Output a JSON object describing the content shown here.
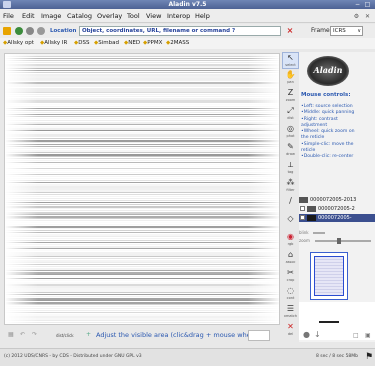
{
  "window": {
    "title": "Aladin v7.5",
    "controls": [
      "−",
      "□"
    ]
  },
  "menu": {
    "items": [
      "File",
      "Edit",
      "Image",
      "Catalog",
      "Overlay",
      "Tool",
      "View",
      "Interop",
      "Help"
    ]
  },
  "toolbar": {
    "location_label": "Location",
    "location_value": "Object, coordinates, URL, filename or command ?",
    "clear": "×",
    "frame_label": "Frame",
    "frame_value": "ICRS",
    "frame_arrow": "∨"
  },
  "surveys": [
    "Allsky opt",
    "Allsky IR",
    "DSS",
    "Simbad",
    "NED",
    "PPMX",
    "2MASS"
  ],
  "tools": [
    {
      "label": "select",
      "icon": "↖"
    },
    {
      "label": "pan",
      "icon": "✋"
    },
    {
      "label": "zoom",
      "icon": "Z"
    },
    {
      "label": "dist",
      "icon": "⤢"
    },
    {
      "label": "phot",
      "icon": "◎"
    },
    {
      "label": "draw",
      "icon": "✎"
    },
    {
      "label": "tag",
      "icon": "⟂"
    },
    {
      "label": "filter",
      "icon": "⁂"
    },
    {
      "label": "",
      "icon": "∕"
    },
    {
      "label": "",
      "icon": "◇"
    },
    {
      "label": "rgb",
      "icon": "◉"
    },
    {
      "label": "assoc",
      "icon": "⌂"
    },
    {
      "label": "crop",
      "icon": "✂"
    },
    {
      "label": "cont",
      "icon": "◌"
    },
    {
      "label": "xmatch",
      "icon": "☰"
    },
    {
      "label": "prop",
      "icon": "☐"
    },
    {
      "label": "del",
      "icon": "✕"
    }
  ],
  "mouse_controls": {
    "title": "Mouse controls:",
    "lines": [
      "•Left: source selection",
      "•Middle: quick panning",
      "•Right: contrast",
      "adjustment",
      "•Wheel: quick zoom on",
      "the reticle",
      "•Simple-clic: move the",
      "reticle",
      "•Double-clic: re-center"
    ]
  },
  "stack": [
    "0000072005-2013",
    "0000072005-2",
    "0000072005-"
  ],
  "controls": {
    "label_a": "blink",
    "label_b": "zoom"
  },
  "footer": {
    "hint": "Adjust the visible area (clic&drag + mouse wheel)",
    "label": "dist/click"
  },
  "status": {
    "copyright": "(c) 2012 UDS/CNRS - by CDS - Distributed under GNU GPL v3",
    "memory": "8 sec / 8 sec  58Mb"
  },
  "colors": {
    "title_bar": "#5a6fa3",
    "accent_blue": "#2a58b0",
    "stack_active": "#3b4f8f"
  }
}
